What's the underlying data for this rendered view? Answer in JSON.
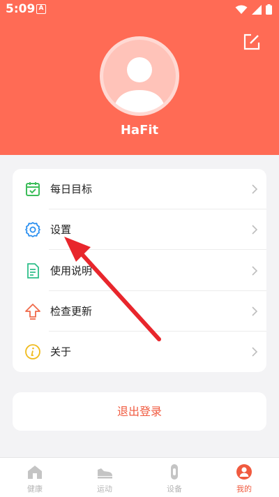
{
  "status": {
    "time": "5:09",
    "notification_letter": "A"
  },
  "profile": {
    "username": "HaFit"
  },
  "menu": {
    "items": [
      {
        "label": "每日目标",
        "icon": "calendar-check-icon"
      },
      {
        "label": "设置",
        "icon": "gear-icon"
      },
      {
        "label": "使用说明",
        "icon": "document-icon"
      },
      {
        "label": "检查更新",
        "icon": "upload-arrow-icon"
      },
      {
        "label": "关于",
        "icon": "info-icon"
      }
    ]
  },
  "logout": {
    "label": "退出登录"
  },
  "tabbar": {
    "tabs": [
      {
        "label": "健康",
        "icon": "home-icon"
      },
      {
        "label": "运动",
        "icon": "sneaker-icon"
      },
      {
        "label": "设备",
        "icon": "band-icon"
      },
      {
        "label": "我的",
        "icon": "person-icon"
      }
    ],
    "active": "我的"
  },
  "colors": {
    "accent": "#ff6b55",
    "logout_text": "#f05a3f",
    "annotation_arrow": "#e8262c"
  }
}
